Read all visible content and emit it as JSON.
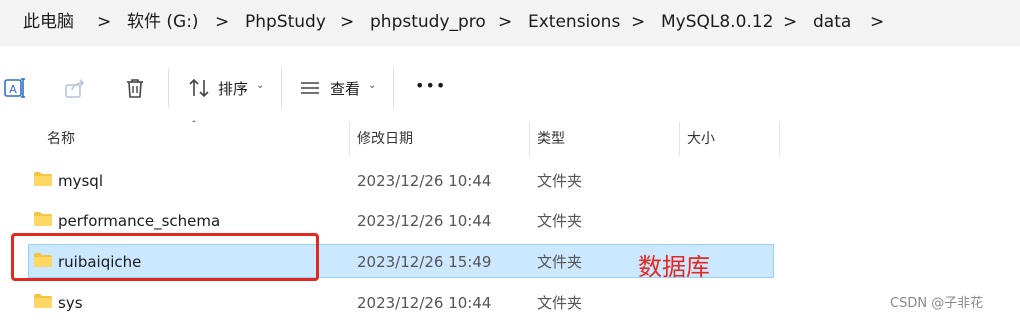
{
  "breadcrumb": {
    "items": [
      "此电脑",
      "软件 (G:)",
      "PhpStudy",
      "phpstudy_pro",
      "Extensions",
      "MySQL8.0.12",
      "data"
    ],
    "separator": ">"
  },
  "toolbar": {
    "sort_label": "排序",
    "view_label": "查看",
    "more_label": "•••",
    "caret": "⌄"
  },
  "columns": {
    "name": "名称",
    "modified": "修改日期",
    "type": "类型",
    "size": "大小"
  },
  "rows": [
    {
      "name": "mysql",
      "modified": "2023/12/26 10:44",
      "type": "文件夹"
    },
    {
      "name": "performance_schema",
      "modified": "2023/12/26 10:44",
      "type": "文件夹"
    },
    {
      "name": "ruibaiqiche",
      "modified": "2023/12/26 15:49",
      "type": "文件夹"
    },
    {
      "name": "sys",
      "modified": "2023/12/26 10:44",
      "type": "文件夹"
    }
  ],
  "annotation": {
    "label": "数据库",
    "color": "#e4281f"
  },
  "watermark": "CSDN @子非花",
  "colors": {
    "selection_fill": "#cce8ff",
    "selection_border": "#99d1ff",
    "folder": "#f5c542"
  }
}
